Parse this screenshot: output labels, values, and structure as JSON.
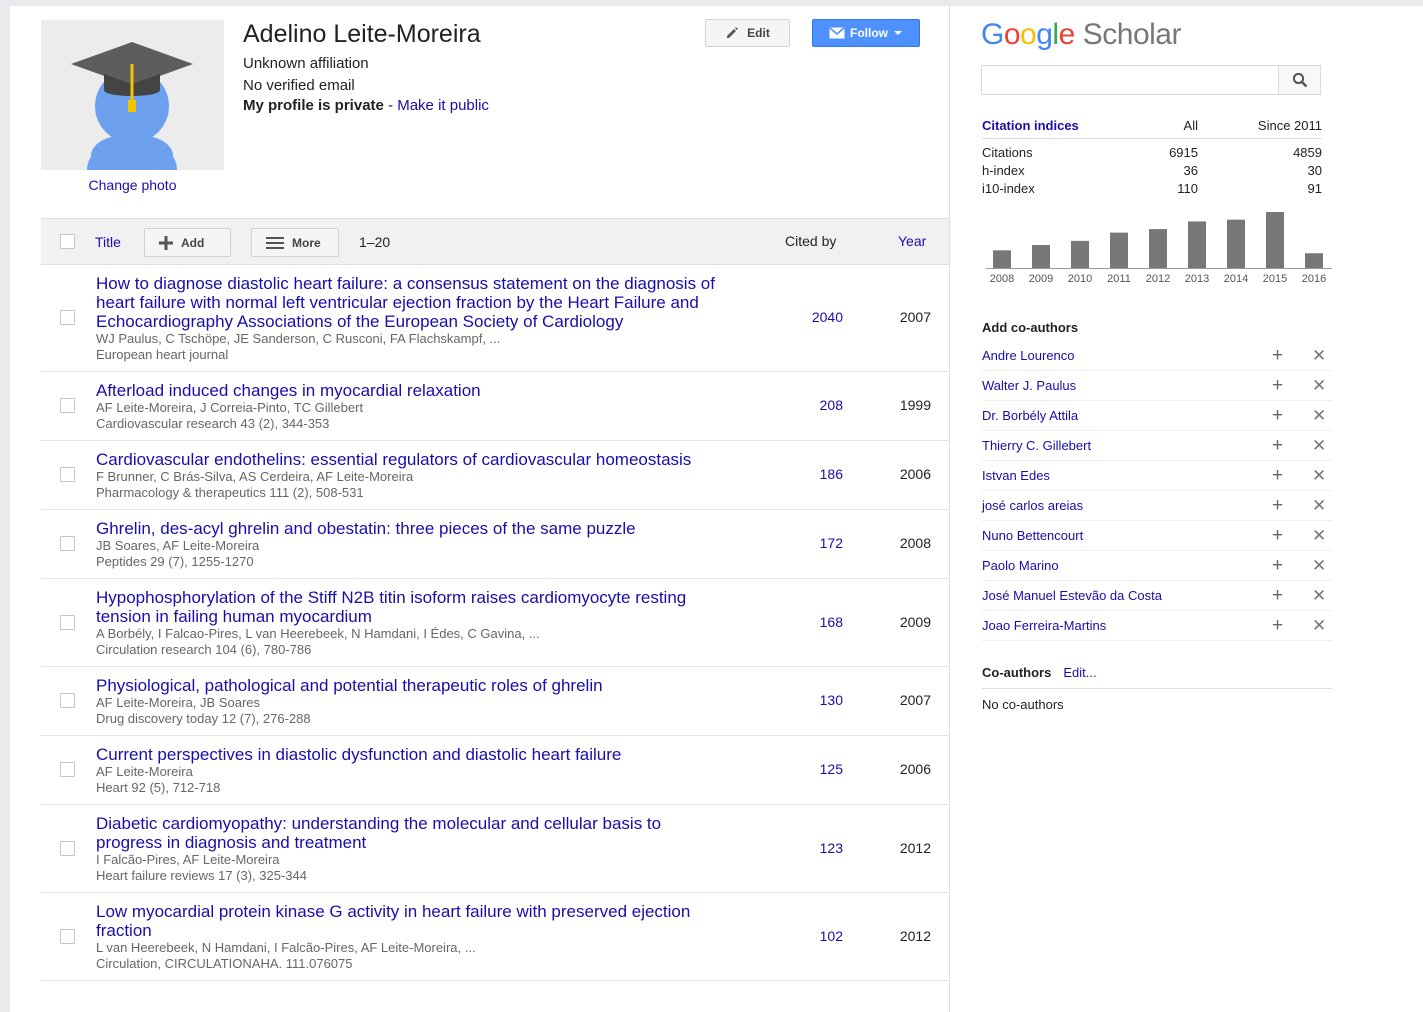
{
  "profile": {
    "name": "Adelino Leite-Moreira",
    "affiliation": "Unknown affiliation",
    "email": "No verified email",
    "private_label": "My profile is private",
    "private_sep": " - ",
    "make_public": "Make it public",
    "change_photo": "Change photo",
    "edit_label": "Edit",
    "follow_label": "Follow"
  },
  "table": {
    "title_header": "Title",
    "add_label": "Add",
    "more_label": "More",
    "range": "1–20",
    "cited_header": "Cited by",
    "year_header": "Year",
    "rows": [
      {
        "title": "How to diagnose diastolic heart failure: a consensus statement on the diagnosis of heart failure with normal left ventricular ejection fraction by the Heart Failure and Echocardiography Associations of the European Society of Cardiology",
        "authors": "WJ Paulus, C Tschöpe, JE Sanderson, C Rusconi, FA Flachskampf, ...",
        "source": "European heart journal",
        "cited": "2040",
        "year": "2007"
      },
      {
        "title": "Afterload induced changes in myocardial relaxation",
        "authors": "AF Leite-Moreira, J Correia-Pinto, TC Gillebert",
        "source": "Cardiovascular research 43 (2), 344-353",
        "cited": "208",
        "year": "1999"
      },
      {
        "title": "Cardiovascular endothelins: essential regulators of cardiovascular homeostasis",
        "authors": "F Brunner, C Brás-Silva, AS Cerdeira, AF Leite-Moreira",
        "source": "Pharmacology & therapeutics 111 (2), 508-531",
        "cited": "186",
        "year": "2006"
      },
      {
        "title": "Ghrelin, des-acyl ghrelin and obestatin: three pieces of the same puzzle",
        "authors": "JB Soares, AF Leite-Moreira",
        "source": "Peptides 29 (7), 1255-1270",
        "cited": "172",
        "year": "2008"
      },
      {
        "title": "Hypophosphorylation of the Stiff N2B titin isoform raises cardiomyocyte resting tension in failing human myocardium",
        "authors": "A Borbély, I Falcao-Pires, L van Heerebeek, N Hamdani, I Édes, C Gavina, ...",
        "source": "Circulation research 104 (6), 780-786",
        "cited": "168",
        "year": "2009"
      },
      {
        "title": "Physiological, pathological and potential therapeutic roles of ghrelin",
        "authors": "AF Leite-Moreira, JB Soares",
        "source": "Drug discovery today 12 (7), 276-288",
        "cited": "130",
        "year": "2007"
      },
      {
        "title": "Current perspectives in diastolic dysfunction and diastolic heart failure",
        "authors": "AF Leite-Moreira",
        "source": "Heart 92 (5), 712-718",
        "cited": "125",
        "year": "2006"
      },
      {
        "title": "Diabetic cardiomyopathy: understanding the molecular and cellular basis to progress in diagnosis and treatment",
        "authors": "I Falcão-Pires, AF Leite-Moreira",
        "source": "Heart failure reviews 17 (3), 325-344",
        "cited": "123",
        "year": "2012"
      },
      {
        "title": "Low myocardial protein kinase G activity in heart failure with preserved ejection fraction",
        "authors": "L van Heerebeek, N Hamdani, I Falcão-Pires, AF Leite-Moreira, ...",
        "source": "Circulation, CIRCULATIONAHA. 111.076075",
        "cited": "102",
        "year": "2012"
      }
    ]
  },
  "sidebar": {
    "logo_google": "Google",
    "logo_scholar": "Scholar",
    "search_placeholder": "",
    "citation_header": "Citation indices",
    "col_all": "All",
    "col_since": "Since 2011",
    "indices": [
      {
        "label": "Citations",
        "all": "6915",
        "since": "4859"
      },
      {
        "label": "h-index",
        "all": "36",
        "since": "30"
      },
      {
        "label": "i10-index",
        "all": "110",
        "since": "91"
      }
    ],
    "add_coauthors_header": "Add co-authors",
    "coauthor_suggestions": [
      "Andre Lourenco",
      "Walter J. Paulus",
      "Dr. Borbély Attila",
      "Thierry C. Gillebert",
      "Istvan Edes",
      "josé carlos areias",
      "Nuno Bettencourt",
      "Paolo Marino",
      "José Manuel Estevão da Costa",
      "Joao Ferreira-Martins"
    ],
    "coauthors_header": "Co-authors",
    "coauthors_edit": "Edit...",
    "no_coauthors": "No co-authors"
  },
  "chart_data": {
    "type": "bar",
    "categories": [
      "2008",
      "2009",
      "2010",
      "2011",
      "2012",
      "2013",
      "2014",
      "2015",
      "2016"
    ],
    "values": [
      300,
      390,
      460,
      600,
      660,
      790,
      820,
      950,
      250
    ],
    "bar_color": "#777777"
  }
}
